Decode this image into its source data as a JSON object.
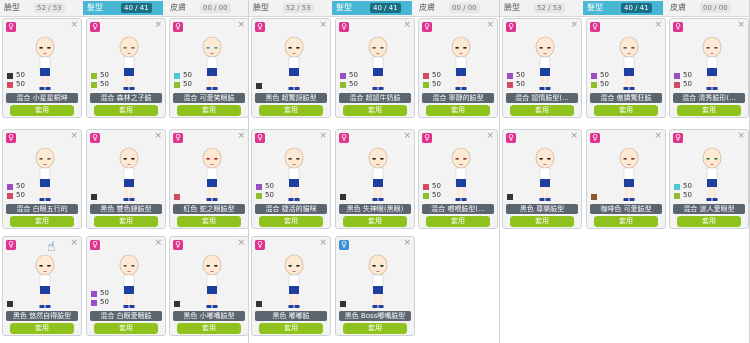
{
  "colors": {
    "tab_active": "#47b7d3",
    "apply": "#8fc21d",
    "name_bg": "#5b6570",
    "gender_female": "#e0338f",
    "gender_other": "#3b8fd6",
    "swatch_red": "#d04b5d",
    "swatch_purple": "#9b4fc2",
    "swatch_green": "#8cbf2a",
    "swatch_cyan": "#4cc7d9",
    "swatch_dark": "#333333",
    "swatch_brown": "#8a5a32"
  },
  "tabs": [
    {
      "label": "臉型",
      "count": "52 / 53"
    },
    {
      "label": "髮型",
      "count": "40 / 41"
    },
    {
      "label": "皮膚",
      "count": "00 / 00"
    }
  ],
  "panels": [
    {
      "id": "p1",
      "cards": [
        {
          "name": "混合 小星星桐坤",
          "stats": [
            {
              "c": "swatch_dark",
              "v": "50"
            },
            {
              "c": "swatch_red",
              "v": "50"
            }
          ],
          "face": "#1f1f1f"
        },
        {
          "name": "混合 森林之子臉",
          "stats": [
            {
              "c": "swatch_green",
              "v": "50"
            },
            {
              "c": "swatch_green",
              "v": "50"
            }
          ],
          "face": "#5e7f3a"
        },
        {
          "name": "混合 可愛笑眼臉",
          "stats": [
            {
              "c": "swatch_cyan",
              "v": "50"
            },
            {
              "c": "swatch_green",
              "v": "50"
            }
          ],
          "face": "#3aa0c0"
        },
        {
          "name": "混合 白眼五行的",
          "stats": [
            {
              "c": "swatch_purple",
              "v": "50"
            },
            {
              "c": "swatch_red",
              "v": "50"
            }
          ],
          "face": "#555555"
        },
        {
          "name": "黑色 雙色鏈臉型",
          "stats": [
            {
              "c": "swatch_dark",
              "v": ""
            }
          ],
          "face": "#1f1f1f"
        },
        {
          "name": "紅色 蛇之眼臉型",
          "stats": [
            {
              "c": "swatch_red",
              "v": ""
            }
          ],
          "face": "#c0202a"
        },
        {
          "name": "黑色 悠然自得臉型",
          "stats": [
            {
              "c": "swatch_dark",
              "v": ""
            }
          ],
          "face": "#1f1f1f",
          "cursor": true
        },
        {
          "name": "混合 白眼愛睏臉",
          "stats": [
            {
              "c": "swatch_purple",
              "v": "50"
            },
            {
              "c": "swatch_purple",
              "v": "50"
            }
          ],
          "face": "#555555"
        },
        {
          "name": "黑色 小嘟嘴臉型",
          "stats": [
            {
              "c": "swatch_dark",
              "v": ""
            }
          ],
          "face": "#1f1f1f"
        }
      ]
    },
    {
      "id": "p2",
      "cards": [
        {
          "name": "黑色 超驚訝臉型",
          "stats": [
            {
              "c": "swatch_dark",
              "v": ""
            }
          ],
          "face": "#1f1f1f"
        },
        {
          "name": "混合 超認牛奶臉",
          "stats": [
            {
              "c": "swatch_purple",
              "v": "50"
            },
            {
              "c": "swatch_green",
              "v": "50"
            }
          ],
          "face": "#555555"
        },
        {
          "name": "混合 寧靜的臉型",
          "stats": [
            {
              "c": "swatch_red",
              "v": "50"
            },
            {
              "c": "swatch_green",
              "v": "50"
            }
          ],
          "face": "#1f1f1f"
        },
        {
          "name": "混合 捷活的貓咪",
          "stats": [
            {
              "c": "swatch_purple",
              "v": "50"
            },
            {
              "c": "swatch_green",
              "v": "50"
            }
          ],
          "face": "#3a3a3a"
        },
        {
          "name": "黑色 失神眼(黑眼)",
          "stats": [
            {
              "c": "swatch_dark",
              "v": ""
            }
          ],
          "face": "#1f1f1f"
        },
        {
          "name": "混合 喂喂臉型(...",
          "stats": [
            {
              "c": "swatch_red",
              "v": "50"
            },
            {
              "c": "swatch_green",
              "v": "50"
            }
          ],
          "face": "#8a3a2a"
        },
        {
          "name": "黑色 嘟嘟臉",
          "stats": [
            {
              "c": "swatch_dark",
              "v": ""
            }
          ],
          "face": "#1f1f1f",
          "gender": "female"
        },
        {
          "name": "黑色 Boss嘟嘴臉型",
          "stats": [
            {
              "c": "swatch_dark",
              "v": ""
            }
          ],
          "face": "#1f1f1f",
          "gender": "other"
        }
      ]
    },
    {
      "id": "p3",
      "cards": [
        {
          "name": "混合 認情臉型(...",
          "stats": [
            {
              "c": "swatch_purple",
              "v": "50"
            },
            {
              "c": "swatch_red",
              "v": "50"
            }
          ],
          "face": "#6a2a2a"
        },
        {
          "name": "混合 傲嬌驚狂臉",
          "stats": [
            {
              "c": "swatch_purple",
              "v": "50"
            },
            {
              "c": "swatch_green",
              "v": "50"
            }
          ],
          "face": "#555555"
        },
        {
          "name": "混合 清秀臉形(...",
          "stats": [
            {
              "c": "swatch_purple",
              "v": "50"
            },
            {
              "c": "swatch_red",
              "v": "50"
            }
          ],
          "face": "#4a4a4a"
        },
        {
          "name": "黑色 尊樂臉型",
          "stats": [
            {
              "c": "swatch_dark",
              "v": ""
            }
          ],
          "face": "#1f1f1f"
        },
        {
          "name": "咖啡色 可愛臉型",
          "stats": [
            {
              "c": "swatch_brown",
              "v": ""
            }
          ],
          "face": "#6a4020"
        },
        {
          "name": "混合 迷人愛眼型",
          "stats": [
            {
              "c": "swatch_cyan",
              "v": "50"
            },
            {
              "c": "swatch_green",
              "v": "50"
            }
          ],
          "face": "#2f7f4a"
        }
      ]
    }
  ],
  "apply_label": "套用",
  "close_glyph": "×",
  "gender_glyph": "♀"
}
